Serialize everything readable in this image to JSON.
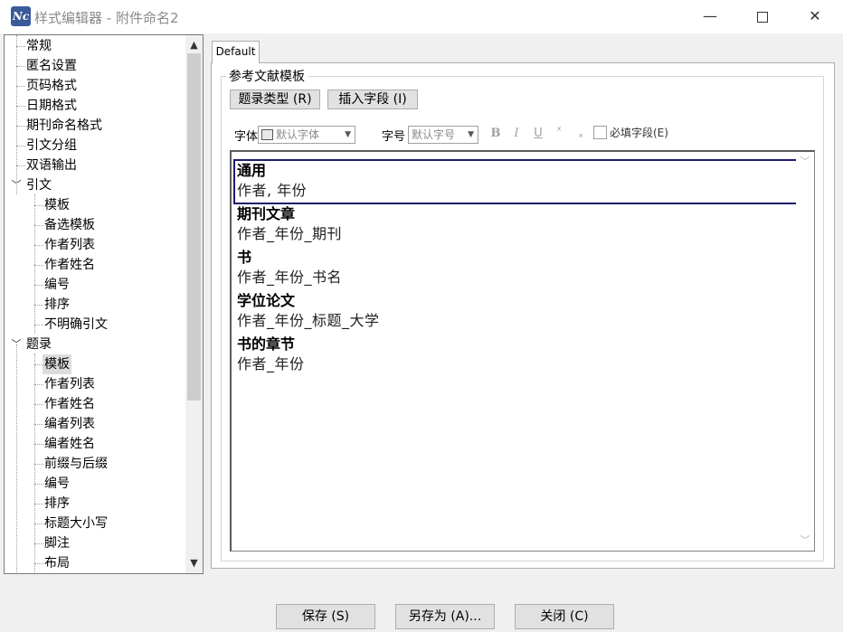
{
  "window": {
    "title": "样式编辑器 - 附件命名2",
    "icon_text": "Nc",
    "minimize": "—",
    "close": "✕"
  },
  "tree": {
    "items": [
      {
        "label": "常规",
        "level": 0
      },
      {
        "label": "匿名设置",
        "level": 0
      },
      {
        "label": "页码格式",
        "level": 0
      },
      {
        "label": "日期格式",
        "level": 0
      },
      {
        "label": "期刊命名格式",
        "level": 0
      },
      {
        "label": "引文分组",
        "level": 0
      },
      {
        "label": "双语输出",
        "level": 0
      },
      {
        "label": "引文",
        "level": 0,
        "expanded": true
      },
      {
        "label": "模板",
        "level": 1
      },
      {
        "label": "备选模板",
        "level": 1
      },
      {
        "label": "作者列表",
        "level": 1
      },
      {
        "label": "作者姓名",
        "level": 1
      },
      {
        "label": "编号",
        "level": 1
      },
      {
        "label": "排序",
        "level": 1
      },
      {
        "label": "不明确引文",
        "level": 1
      },
      {
        "label": "题录",
        "level": 0,
        "expanded": true
      },
      {
        "label": "模板",
        "level": 1,
        "selected": true
      },
      {
        "label": "作者列表",
        "level": 1
      },
      {
        "label": "作者姓名",
        "level": 1
      },
      {
        "label": "编者列表",
        "level": 1
      },
      {
        "label": "编者姓名",
        "level": 1
      },
      {
        "label": "前缀与后缀",
        "level": 1
      },
      {
        "label": "编号",
        "level": 1
      },
      {
        "label": "排序",
        "level": 1
      },
      {
        "label": "标题大小写",
        "level": 1
      },
      {
        "label": "脚注",
        "level": 1
      },
      {
        "label": "布局",
        "level": 1
      }
    ],
    "scroll_up_icon": "▲",
    "scroll_down_icon": "▼",
    "chevron_expanded": "﹀"
  },
  "tab": {
    "label": "Default"
  },
  "group": {
    "title": "参考文献模板"
  },
  "toolbar": {
    "ref_type_button": "题录类型 (R)",
    "insert_field_button": "插入字段 (I)",
    "font_label": "字体",
    "font_value": "默认字体",
    "size_label": "字号",
    "size_value": "默认字号",
    "bold": "B",
    "italic": "I",
    "underline": "U",
    "superscript": "ˣ",
    "subscript": "ₓ",
    "required_field_label": "必填字段(E)",
    "dropdown_arrow": "▼"
  },
  "templates": [
    {
      "type": "通用",
      "template": "作者, 年份"
    },
    {
      "type": "期刊文章",
      "template": "作者_年份_期刊"
    },
    {
      "type": "书",
      "template": "作者_年份_书名"
    },
    {
      "type": "学位论文",
      "template": "作者_年份_标题_大学"
    },
    {
      "type": "书的章节",
      "template": "作者_年份"
    }
  ],
  "buttons": {
    "save": "保存 (S)",
    "save_as": "另存为 (A)...",
    "close": "关闭 (C)"
  }
}
